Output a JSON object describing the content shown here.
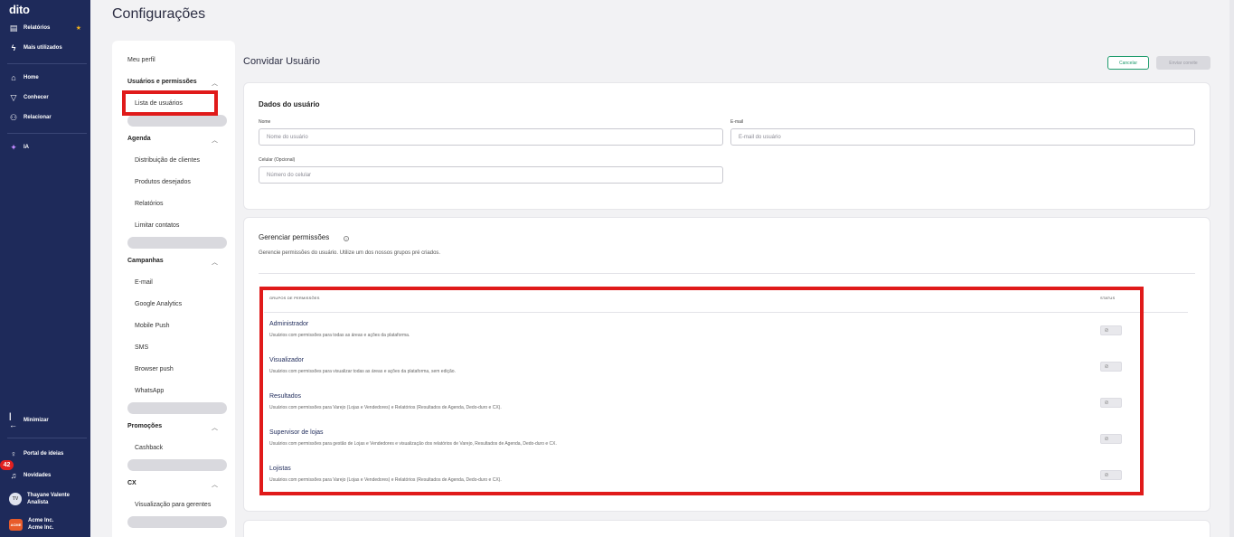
{
  "app": {
    "logo": "dito",
    "page_title": "Configurações"
  },
  "leftnav": {
    "top_items": [
      {
        "label": "Relatórios",
        "icon": "report-icon"
      },
      {
        "label": "Mais utilizados",
        "icon": "bolt-icon"
      }
    ],
    "main_items": [
      {
        "label": "Home",
        "icon": "home-icon"
      },
      {
        "label": "Conhecer",
        "icon": "filter-icon"
      },
      {
        "label": "Relacionar",
        "icon": "users-icon"
      }
    ],
    "ai_item": {
      "label": "IA",
      "icon": "sparkle-icon"
    },
    "minimize": "Minimizar",
    "portal": "Portal de ideias",
    "novidades": "Novidades",
    "badge": "42",
    "user": {
      "initials": "TV",
      "name": "Thayane Valente",
      "role": "Analista"
    },
    "company": {
      "logo": "ACME",
      "name": "Acme Inc.",
      "sub": "Acme Inc."
    }
  },
  "settings_menu": {
    "meu_perfil": "Meu perfil",
    "usuarios_head": "Usuários e permissões",
    "lista_usuarios": "Lista de usuários",
    "agenda_head": "Agenda",
    "agenda_items": [
      "Distribuição de clientes",
      "Produtos desejados",
      "Relatórios",
      "Limitar contatos"
    ],
    "campanhas_head": "Campanhas",
    "campanhas_items": [
      "E-mail",
      "Google Analytics",
      "Mobile Push",
      "SMS",
      "Browser push",
      "WhatsApp"
    ],
    "promocoes_head": "Promoções",
    "promocoes_items": [
      "Cashback"
    ],
    "cx_head": "CX",
    "cx_items": [
      "Visualização para gerentes"
    ]
  },
  "main": {
    "title": "Convidar Usuário",
    "cancel": "Cancelar",
    "send": "Enviar convite",
    "user_card": {
      "title": "Dados do usuário",
      "name_label": "Nome",
      "name_placeholder": "Nome do usuário",
      "email_label": "E-mail",
      "email_placeholder": "E-mail do usuário",
      "phone_label": "Celular (Opcional)",
      "phone_placeholder": "Número do celular"
    },
    "perm_card": {
      "title": "Gerenciar permissões",
      "subtitle": "Gerencie permissões do usuário. Utilize um dos nossos grupos pré criados.",
      "col_groups": "GRUPOS DE PERMISSÕES",
      "col_status": "STATUS",
      "groups": [
        {
          "name": "Administrador",
          "desc": "Usuários com permissões para todas as áreas e ações da plataforma."
        },
        {
          "name": "Visualizador",
          "desc": "Usuários com permissões para visualizar todas as áreas e ações da plataforma, sem edição."
        },
        {
          "name": "Resultados",
          "desc": "Usuários com permissões para Varejo (Lojas e Vendedores) e Relatórios (Resultados de Agenda, Dedo-duro e CX)."
        },
        {
          "name": "Supervisor de lojas",
          "desc": "Usuários com permissões para gestão de Lojas e Vendedores e visualização dos relatórios de Varejo, Resultados de Agenda, Dedo-duro e CX."
        },
        {
          "name": "Lojistas",
          "desc": "Usuários com permissões para Varejo (Lojas e Vendedores) e Relatórios (Resultados de Agenda, Dedo-duro e CX)."
        }
      ]
    }
  }
}
